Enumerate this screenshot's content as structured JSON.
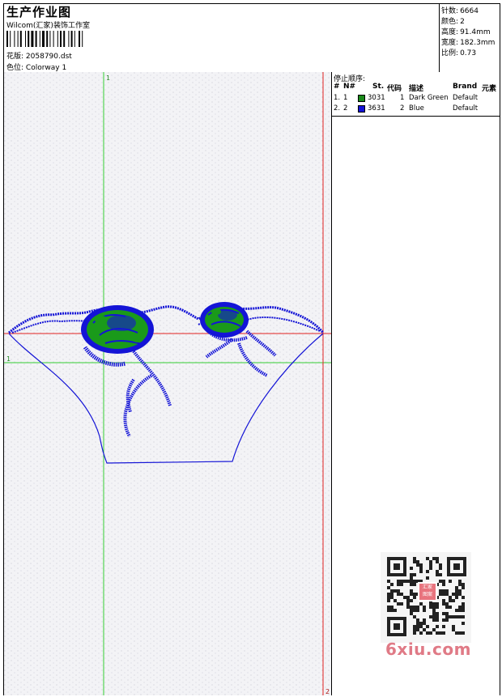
{
  "header": {
    "title": "生产作业图",
    "subtitle": "Wilcom(汇家)装饰工作室",
    "design_label": "花版:",
    "design_value": "2058790.dst",
    "color_label": "色位:",
    "color_value": "Colorway 1"
  },
  "stats": [
    {
      "label": "针数",
      "value": "6664"
    },
    {
      "label": "颜色",
      "value": "2"
    },
    {
      "label": "高度",
      "value": "91.4mm"
    },
    {
      "label": "宽度",
      "value": "182.3mm"
    },
    {
      "label": "比例",
      "value": "0.73"
    }
  ],
  "stop_sequence": {
    "title": "停止顺序:",
    "columns": [
      "#",
      "N#",
      "St.",
      "代码",
      "描述",
      "Brand",
      "元素"
    ],
    "rows": [
      {
        "index": "1.",
        "needle": "1",
        "color": "#1a8a1a",
        "stitches": "3031",
        "code": "1",
        "description": "Dark Green",
        "brand": "Default"
      },
      {
        "index": "2.",
        "needle": "2",
        "color": "#1414d6",
        "stitches": "3631",
        "code": "2",
        "description": "Blue",
        "brand": "Default"
      }
    ]
  },
  "canvas": {
    "guide_top_label": "1",
    "guide_left_label": "1",
    "guide_right_label": "2",
    "colors": {
      "green": "#1a9a1a",
      "blue": "#1414d6",
      "guide_green": "#33cc33",
      "guide_red": "#e02020"
    }
  },
  "watermark": {
    "text": "6xiu.com",
    "seal_text": "汇家\n图案"
  }
}
